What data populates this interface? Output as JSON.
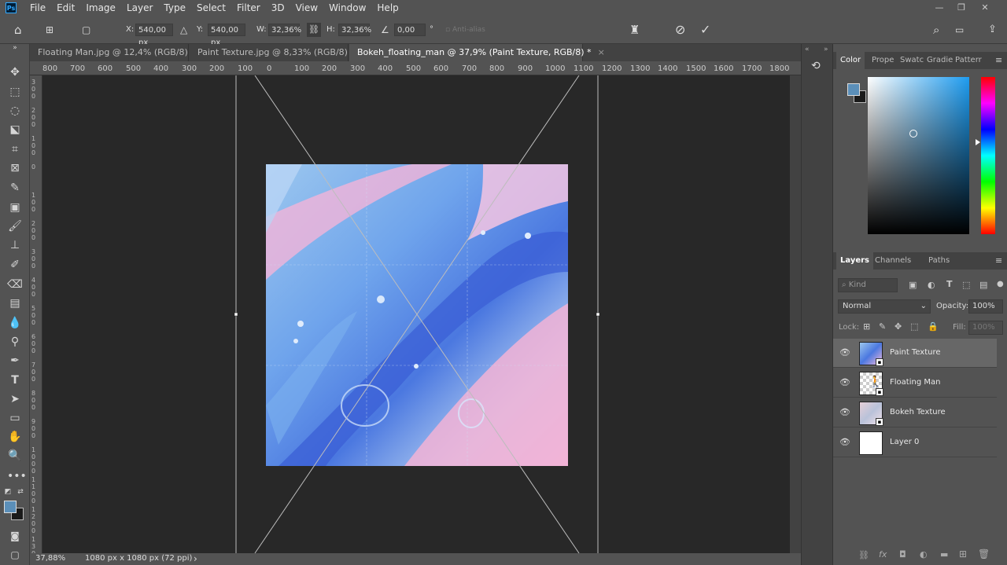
{
  "app": {
    "logo": "Ps"
  },
  "menu": [
    "File",
    "Edit",
    "Image",
    "Layer",
    "Type",
    "Select",
    "Filter",
    "3D",
    "View",
    "Window",
    "Help"
  ],
  "options": {
    "x_label": "X:",
    "x_value": "540,00 px",
    "y_label": "Y:",
    "y_value": "540,00 px",
    "w_label": "W:",
    "w_value": "32,36%",
    "h_label": "H:",
    "h_value": "32,36%",
    "angle_value": "0,00",
    "angle_unit": "°",
    "antialias": "Anti-alias"
  },
  "tabs": [
    {
      "label": "Floating Man.jpg @ 12,4% (RGB/8)",
      "close": "×"
    },
    {
      "label": "Paint Texture.jpg @ 8,33% (RGB/8)",
      "close": "×"
    },
    {
      "label": "Bokeh_floating_man @ 37,9% (Paint Texture, RGB/8) *",
      "close": "×"
    }
  ],
  "ruler": {
    "top": [
      "800",
      "700",
      "600",
      "500",
      "400",
      "300",
      "200",
      "100",
      "0",
      "100",
      "200",
      "300",
      "400",
      "500",
      "600",
      "700",
      "800",
      "900",
      "1000",
      "1100",
      "1200",
      "1300",
      "1400",
      "1500",
      "1600",
      "1700",
      "1800"
    ]
  },
  "status": {
    "zoom": "37,88%",
    "doc_size": "1080 px x 1080 px (72 ppi)",
    "arrow": "›"
  },
  "panels": {
    "top_tabs": [
      "Color",
      "Prope",
      "Swatc",
      "Gradie",
      "Patterr"
    ],
    "layer_tabs": [
      "Layers",
      "Channels",
      "Paths"
    ],
    "kind_placeholder": "Kind",
    "blend_mode": "Normal",
    "opacity_label": "Opacity:",
    "opacity_value": "100%",
    "lock_label": "Lock:",
    "fill_label": "Fill:",
    "fill_value": "100%"
  },
  "layers": [
    {
      "name": "Paint Texture",
      "selected": true
    },
    {
      "name": "Floating Man",
      "selected": false
    },
    {
      "name": "Bokeh Texture",
      "selected": false
    },
    {
      "name": "Layer 0",
      "selected": false
    }
  ],
  "colors": {
    "foreground": "#5b8fb9",
    "background": "#1a1a1a",
    "accent": "#31a8ff"
  }
}
